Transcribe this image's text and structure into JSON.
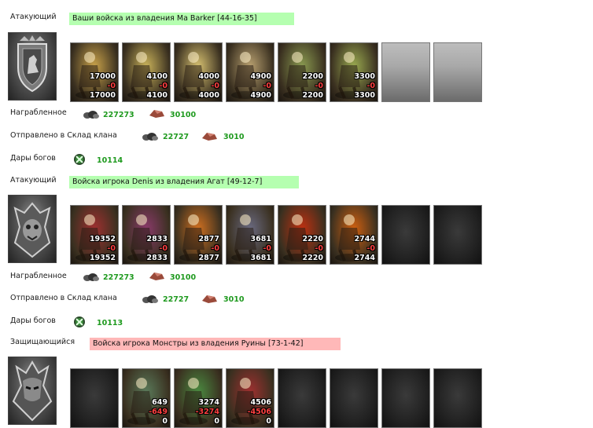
{
  "battles": [
    {
      "role": "Атакующий",
      "banner": "Ваши войска из владения Ma Barker [44-16-35]",
      "banner_color": "#b5ffb0",
      "units": [
        {
          "n1": "17000",
          "n2": "-0",
          "n3": "17000",
          "hue": "#c9a24a"
        },
        {
          "n1": "4100",
          "n2": "-0",
          "n3": "4100",
          "hue": "#c9b25a"
        },
        {
          "n1": "4000",
          "n2": "-0",
          "n3": "4000",
          "hue": "#d6c070"
        },
        {
          "n1": "4900",
          "n2": "-0",
          "n3": "4900",
          "hue": "#b8a070"
        },
        {
          "n1": "2200",
          "n2": "-0",
          "n3": "2200",
          "hue": "#8a9a50"
        },
        {
          "n1": "3300",
          "n2": "-0",
          "n3": "3300",
          "hue": "#9aaa50"
        }
      ],
      "loot_label": "Награбленное",
      "loot_ore": "227273",
      "loot_crystal": "30100",
      "clan_label": "Отправлено в Склад клана",
      "clan_ore": "22727",
      "clan_crystal": "3010",
      "gifts_label": "Дары богов",
      "gifts_value": "10114"
    },
    {
      "role": "Атакующий",
      "banner": "Войска игрока Denis из владения Агат [49-12-7]",
      "banner_color": "#b5ffb0",
      "units": [
        {
          "n1": "19352",
          "n2": "-0",
          "n3": "19352",
          "hue": "#a03030"
        },
        {
          "n1": "2833",
          "n2": "-0",
          "n3": "2833",
          "hue": "#8a3a6a"
        },
        {
          "n1": "2877",
          "n2": "-0",
          "n3": "2877",
          "hue": "#d07020"
        },
        {
          "n1": "3681",
          "n2": "-0",
          "n3": "3681",
          "hue": "#6a6a80"
        },
        {
          "n1": "2220",
          "n2": "-0",
          "n3": "2220",
          "hue": "#c03010"
        },
        {
          "n1": "2744",
          "n2": "-0",
          "n3": "2744",
          "hue": "#d06010"
        }
      ],
      "loot_label": "Награбленное",
      "loot_ore": "227273",
      "loot_crystal": "30100",
      "clan_label": "Отправлено в Склад клана",
      "clan_ore": "22727",
      "clan_crystal": "3010",
      "gifts_label": "Дары богов",
      "gifts_value": "10113"
    },
    {
      "role": "Защищающийся",
      "banner": "Войска игрока Монстры из владения Руины [73-1-42]",
      "banner_color": "#ffb8b8",
      "units": [
        {
          "n1": "649",
          "n2": "-649",
          "n3": "0",
          "hue": "#5a7a5a"
        },
        {
          "n1": "3274",
          "n2": "-3274",
          "n3": "0",
          "hue": "#4a8a40"
        },
        {
          "n1": "4506",
          "n2": "-4506",
          "n3": "0",
          "hue": "#a03030"
        }
      ]
    }
  ],
  "colors": {
    "value_green": "#1f9a1f",
    "loss_red": "#ff4040"
  }
}
